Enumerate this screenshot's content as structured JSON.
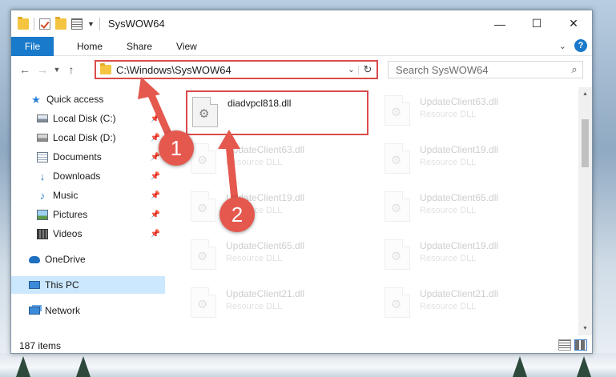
{
  "window": {
    "title": "SysWOW64"
  },
  "controls": {
    "minimize": "—",
    "maximize": "☐",
    "close": "✕"
  },
  "ribbon": {
    "file": "File",
    "tabs": [
      "Home",
      "Share",
      "View"
    ]
  },
  "address": {
    "path": "C:\\Windows\\SysWOW64"
  },
  "search": {
    "placeholder": "Search SysWOW64"
  },
  "sidebar": {
    "items": [
      {
        "label": "Quick access",
        "icon": "star-icon",
        "pinned": false
      },
      {
        "label": "Local Disk (C:)",
        "icon": "drive-icon",
        "pinned": true
      },
      {
        "label": "Local Disk (D:)",
        "icon": "drive-icon",
        "pinned": true
      },
      {
        "label": "Documents",
        "icon": "document-icon",
        "pinned": true
      },
      {
        "label": "Downloads",
        "icon": "download-icon",
        "pinned": true
      },
      {
        "label": "Music",
        "icon": "music-icon",
        "pinned": true
      },
      {
        "label": "Pictures",
        "icon": "pictures-icon",
        "pinned": true
      },
      {
        "label": "Videos",
        "icon": "videos-icon",
        "pinned": true
      },
      {
        "label": "OneDrive",
        "icon": "cloud-icon",
        "pinned": false
      },
      {
        "label": "This PC",
        "icon": "computer-icon",
        "pinned": false,
        "selected": true
      },
      {
        "label": "Network",
        "icon": "network-icon",
        "pinned": false
      }
    ]
  },
  "files": [
    {
      "name": "diadvpcl818.dll",
      "type": "",
      "highlighted": true
    },
    {
      "name": "UpdateClient63.dll",
      "type": "Resource DLL",
      "highlighted": false
    },
    {
      "name": "UpdateClient63.dll",
      "type": "Resource DLL",
      "highlighted": false
    },
    {
      "name": "UpdateClient19.dll",
      "type": "Resource DLL",
      "highlighted": false
    },
    {
      "name": "UpdateClient19.dll",
      "type": "Resource DLL",
      "highlighted": false
    },
    {
      "name": "UpdateClient65.dll",
      "type": "Resource DLL",
      "highlighted": false
    },
    {
      "name": "UpdateClient65.dll",
      "type": "Resource DLL",
      "highlighted": false
    },
    {
      "name": "UpdateClient19.dll",
      "type": "Resource DLL",
      "highlighted": false
    },
    {
      "name": "UpdateClient21.dll",
      "type": "Resource DLL",
      "highlighted": false
    },
    {
      "name": "UpdateClient21.dll",
      "type": "Resource DLL",
      "highlighted": false
    }
  ],
  "status": {
    "count": "187 items"
  },
  "annotations": {
    "step1": "1",
    "step2": "2",
    "color": "#e4584e"
  }
}
